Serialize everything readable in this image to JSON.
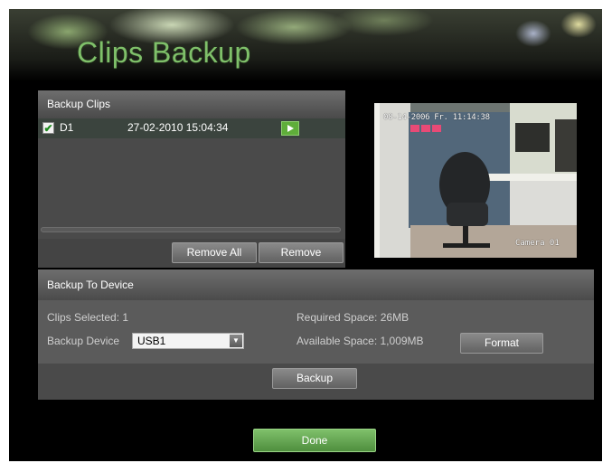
{
  "page": {
    "title": "Clips Backup"
  },
  "clips_panel": {
    "header": "Backup Clips",
    "rows": [
      {
        "checked": true,
        "check_mark": "✔",
        "channel": "D1",
        "time": "27-02-2010 15:04:34",
        "play_icon": "play-icon"
      }
    ],
    "remove_all_label": "Remove All",
    "remove_label": "Remove"
  },
  "preview": {
    "timestamp": "08-14-2006 Fr. 11:14:38",
    "camera_label": "Camera 01"
  },
  "device_panel": {
    "header": "Backup To Device",
    "clips_selected": "Clips Selected: 1",
    "backup_device_label": "Backup Device",
    "device_value": "USB1",
    "dropdown_arrow": "▼",
    "required_space": "Required Space: 26MB",
    "available_space": "Available Space: 1,009MB",
    "format_label": "Format",
    "backup_label": "Backup"
  },
  "done_label": "Done",
  "colors": {
    "title_green": "#7fc06a",
    "done_green": "#5fa24c",
    "play_green": "#5fae3a"
  }
}
